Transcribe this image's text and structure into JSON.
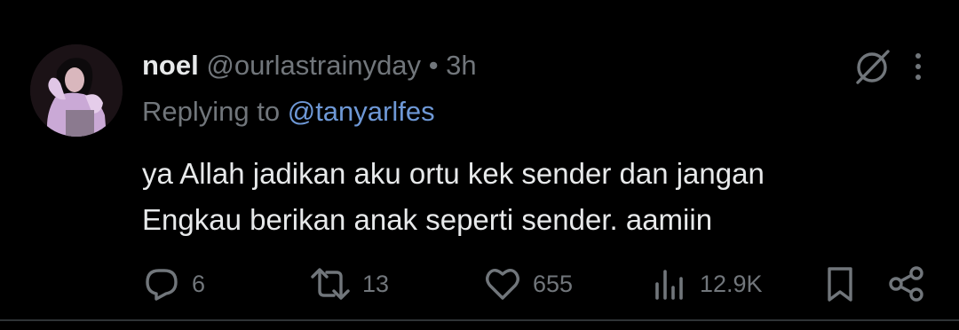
{
  "author": {
    "name": "noel",
    "handle": "@ourlastrainyday",
    "separator": "•",
    "time": "3h"
  },
  "reply": {
    "prefix": "Replying to",
    "mention": "@tanyarlfes"
  },
  "body": {
    "line1": "ya Allah jadikan aku ortu kek sender dan jangan",
    "line2": "Engkau berikan anak seperti sender. aamiin"
  },
  "metrics": {
    "replies": "6",
    "reposts": "13",
    "likes": "655",
    "views": "12.9K"
  },
  "icons": {
    "top": [
      "grok-icon",
      "more-icon"
    ],
    "actions": [
      "reply-icon",
      "repost-icon",
      "like-icon",
      "views-icon",
      "bookmark-icon",
      "share-icon"
    ]
  },
  "colors": {
    "background": "#000000",
    "text": "#e7e9ea",
    "secondary": "#71767b",
    "mention": "#6e98d6"
  }
}
